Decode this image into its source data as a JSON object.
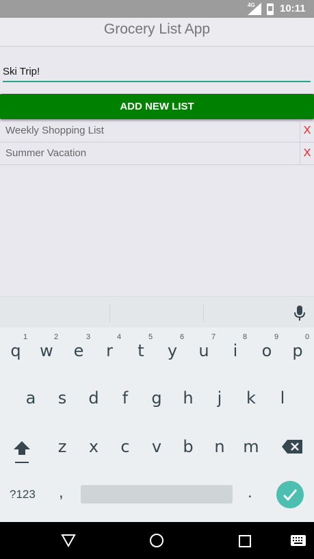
{
  "status_bar": {
    "network": "4G",
    "time": "10:11"
  },
  "app": {
    "title": "Grocery List App"
  },
  "input": {
    "value": "Ski Trip!"
  },
  "add_button": {
    "label": "ADD NEW LIST"
  },
  "lists": [
    {
      "name": "Weekly Shopping List",
      "delete_label": "X"
    },
    {
      "name": "Summer Vacation",
      "delete_label": "X"
    }
  ],
  "keyboard": {
    "row1": [
      "q",
      "w",
      "e",
      "r",
      "t",
      "y",
      "u",
      "i",
      "o",
      "p"
    ],
    "row1_numbers": [
      "1",
      "2",
      "3",
      "4",
      "5",
      "6",
      "7",
      "8",
      "9",
      "0"
    ],
    "row2": [
      "a",
      "s",
      "d",
      "f",
      "g",
      "h",
      "j",
      "k",
      "l"
    ],
    "row3": [
      "z",
      "x",
      "c",
      "v",
      "b",
      "n",
      "m"
    ],
    "symbols_label": "?123",
    "comma": ",",
    "period": ".",
    "accent_color": "#4dbfb0"
  },
  "colors": {
    "add_button": "#008000",
    "delete_x": "#ff1a1a",
    "input_underline": "#2a9d8f"
  },
  "icons": {
    "mic": "mic-icon",
    "shift": "shift-icon",
    "backspace": "backspace-icon",
    "enter": "check-icon",
    "nav_back": "triangle-back-icon",
    "nav_home": "circle-home-icon",
    "nav_recents": "square-recents-icon",
    "nav_keyboard": "keyboard-icon"
  }
}
